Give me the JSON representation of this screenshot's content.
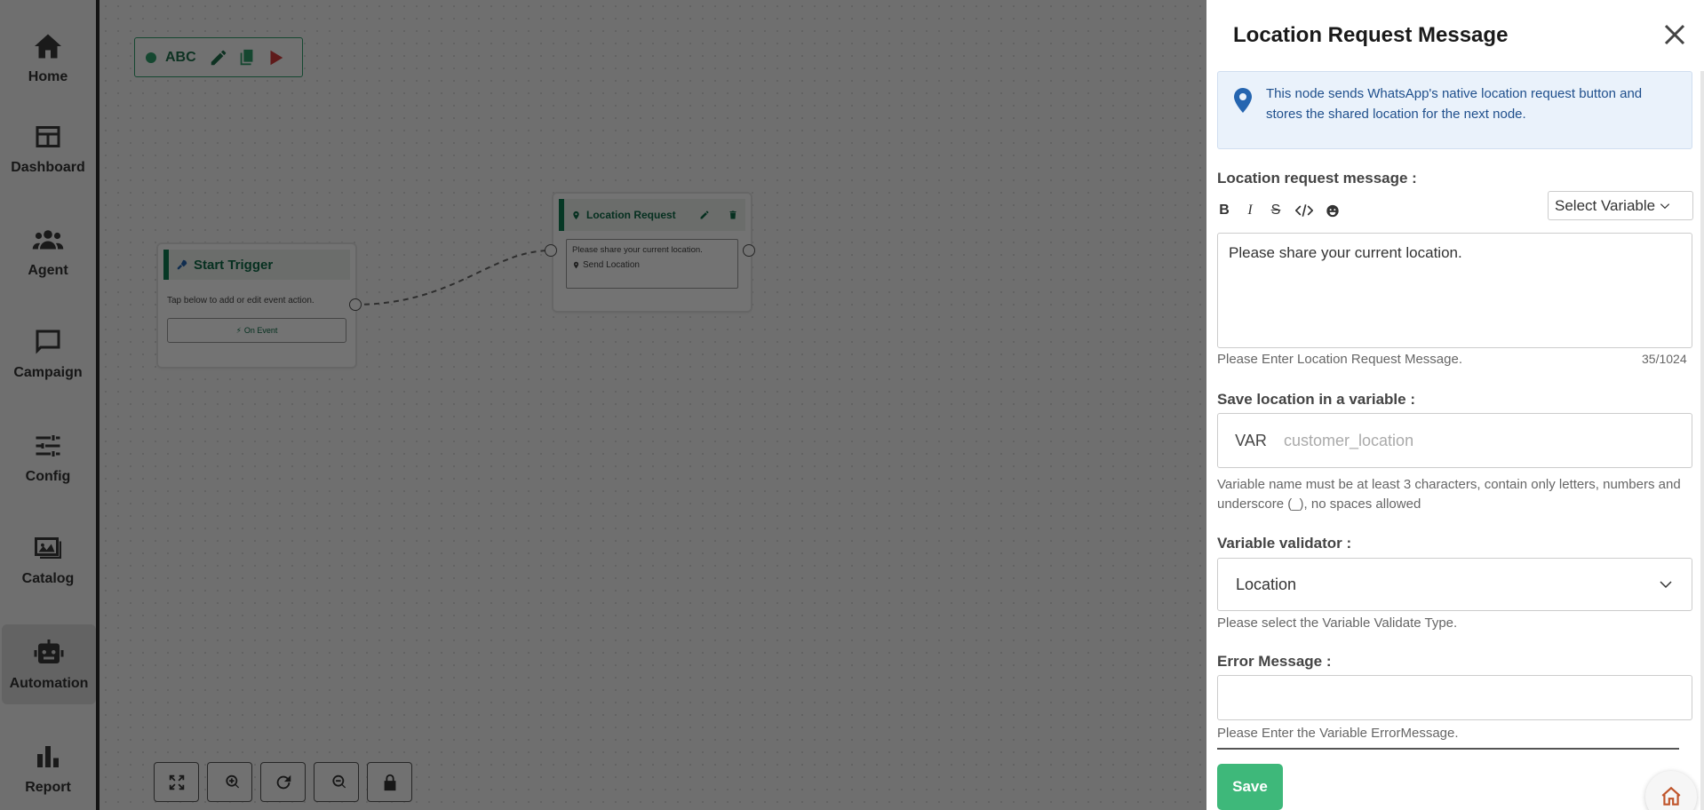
{
  "sidebar": {
    "items": [
      {
        "label": "Home",
        "icon": "home-icon"
      },
      {
        "label": "Dashboard",
        "icon": "dashboard-icon"
      },
      {
        "label": "Agent",
        "icon": "agent-icon"
      },
      {
        "label": "Campaign",
        "icon": "campaign-icon"
      },
      {
        "label": "Config",
        "icon": "config-icon"
      },
      {
        "label": "Catalog",
        "icon": "catalog-icon"
      },
      {
        "label": "Automation",
        "icon": "automation-icon",
        "active": true
      },
      {
        "label": "Report",
        "icon": "report-icon"
      }
    ]
  },
  "flow": {
    "name": "ABC",
    "start_node": {
      "title": "Start Trigger",
      "description": "Tap below to add or edit event action.",
      "event_button": "On Event"
    },
    "location_node": {
      "title": "Location Request",
      "message": "Please share your current location.",
      "button": "Send Location"
    }
  },
  "drawer": {
    "title": "Location Request Message",
    "info": "This node sends WhatsApp's native location request button and stores the shared location for the next node.",
    "message_label": "Location request message :",
    "select_variable": "Select Variable",
    "message_value": "Please share your current location.",
    "message_help": "Please Enter Location Request Message.",
    "counter": "35/1024",
    "save_var_label": "Save location in a variable :",
    "var_prefix": "VAR",
    "var_placeholder": "customer_location",
    "var_help": "Variable name must be at least 3 characters, contain only letters, numbers and underscore (_), no spaces allowed",
    "validator_label": "Variable validator :",
    "validator_value": "Location",
    "validator_help": "Please select the Variable Validate Type.",
    "error_label": "Error Message :",
    "error_value": "",
    "error_help": "Please Enter the Variable ErrorMessage.",
    "save_label": "Save"
  },
  "colors": {
    "accent_green": "#3eb87a",
    "node_green": "#0e7c52",
    "info_bg": "#eaf2fb",
    "info_text": "#1f4f8c"
  }
}
